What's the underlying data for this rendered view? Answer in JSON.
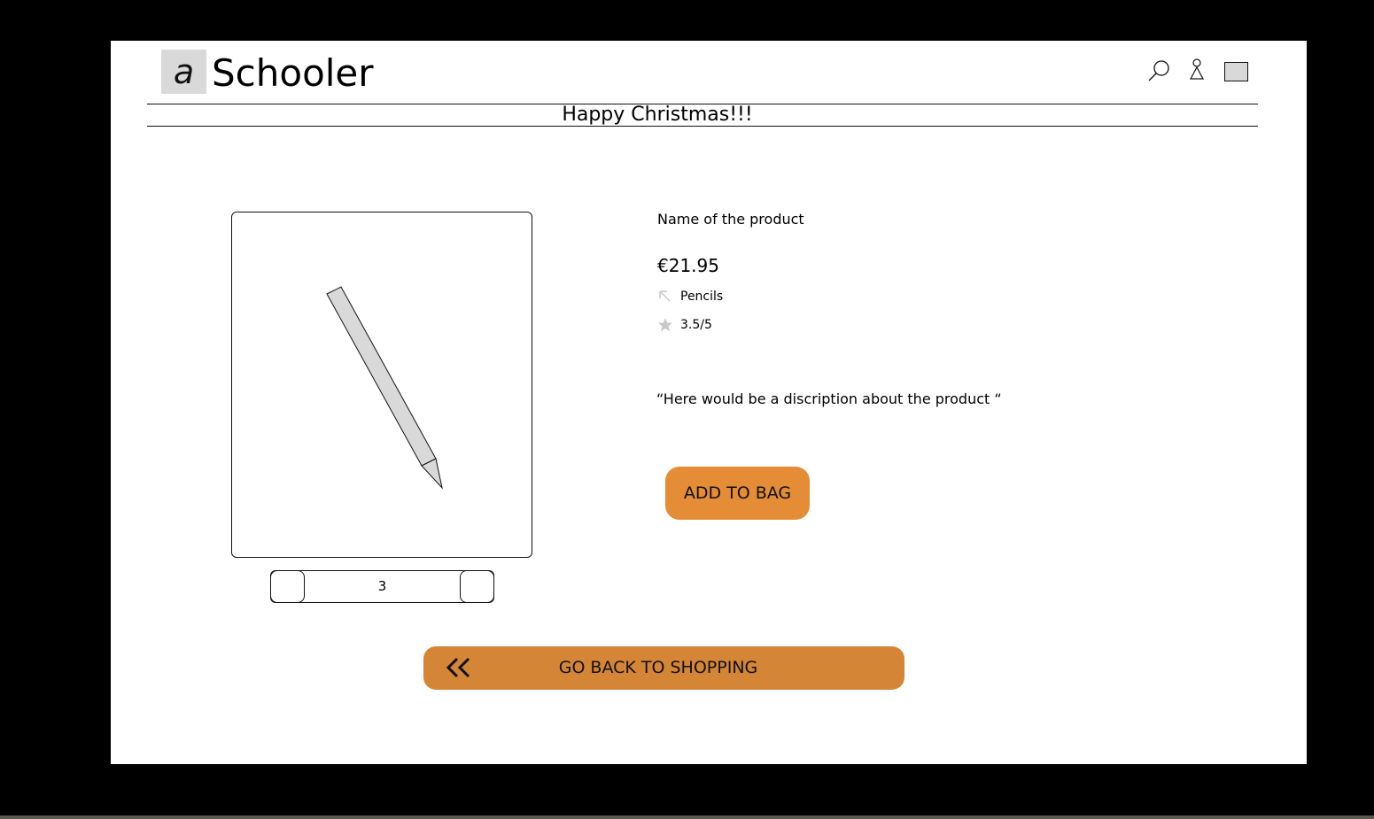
{
  "header": {
    "logo_letter": "a",
    "brand_name": "Schooler",
    "icons": [
      "search-icon",
      "user-icon",
      "bag-icon"
    ]
  },
  "banner": {
    "text": "Happy Christmas!!!"
  },
  "product": {
    "name": "Name of the product",
    "price": "€21.95",
    "category": "Pencils",
    "rating": "3.5/5",
    "description": "“Here would be a discription about the product “",
    "quantity": "3"
  },
  "actions": {
    "add_to_bag_label": "ADD TO BAG",
    "back_label": "GO BACK TO SHOPPING"
  },
  "colors": {
    "accent": "#e58c36",
    "back_button": "#d48536",
    "placeholder_gray": "#d9d9d9"
  }
}
